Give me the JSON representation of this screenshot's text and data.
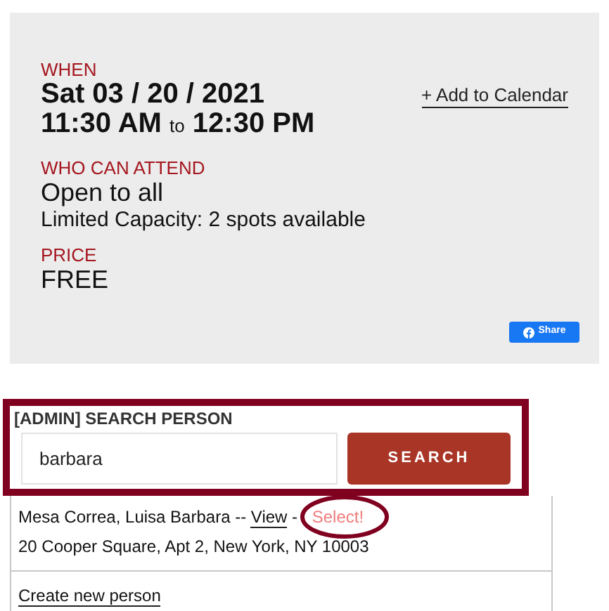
{
  "event": {
    "when_label": "WHEN",
    "date": "Sat 03 / 20 / 2021",
    "start": "11:30 AM",
    "to": "to",
    "end": "12:30 PM",
    "add_to_calendar": "+ Add to Calendar",
    "attend_label": "WHO CAN ATTEND",
    "attend": "Open to all",
    "capacity": "Limited Capacity: 2 spots available",
    "price_label": "PRICE",
    "price": "FREE",
    "share": "Share"
  },
  "search": {
    "title": "[ADMIN] SEARCH PERSON",
    "value": "barbara",
    "button": "SEARCH"
  },
  "results": [
    {
      "name": "Mesa Correa, Luisa Barbara --",
      "view": "View",
      "separator": "-",
      "select": "Select!",
      "address": "20 Cooper Square, Apt 2, New York, NY 10003",
      "highlighted": true
    }
  ],
  "create": "Create new person"
}
